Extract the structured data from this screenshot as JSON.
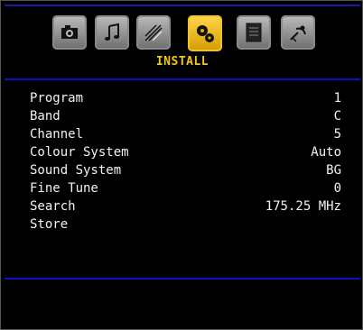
{
  "header": {
    "tabs": [
      {
        "icon": "camera-icon",
        "active": false
      },
      {
        "icon": "music-note-icon",
        "active": false
      },
      {
        "icon": "tools-icon",
        "active": false
      },
      {
        "icon": "gears-icon",
        "active": true
      },
      {
        "icon": "document-icon",
        "active": false
      },
      {
        "icon": "satellite-icon",
        "active": false
      }
    ],
    "title": "INSTALL"
  },
  "menu": {
    "items": [
      {
        "label": "Program",
        "value": "1"
      },
      {
        "label": "Band",
        "value": "C"
      },
      {
        "label": "Channel",
        "value": "5"
      },
      {
        "label": "Colour System",
        "value": "Auto"
      },
      {
        "label": "Sound System",
        "value": "BG"
      },
      {
        "label": "Fine Tune",
        "value": "0"
      },
      {
        "label": "Search",
        "value": "175.25 MHz"
      },
      {
        "label": "Store",
        "value": ""
      }
    ]
  },
  "colors": {
    "accent": "#f4c814",
    "separator": "#1010c0",
    "text": "#f2f2f2",
    "background": "#000000"
  }
}
